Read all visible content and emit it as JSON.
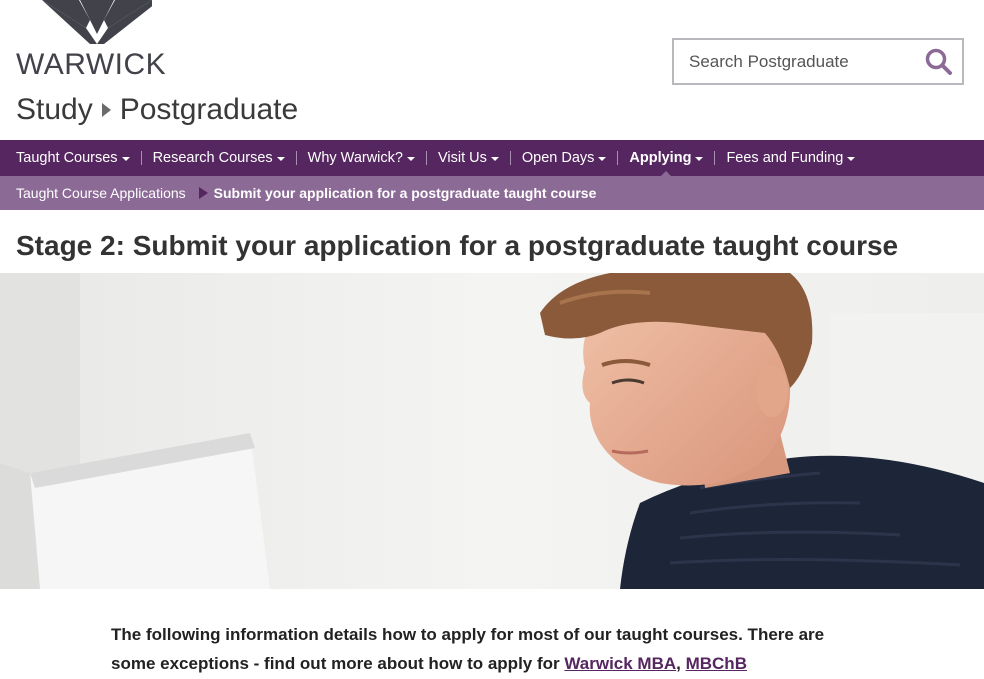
{
  "header": {
    "logo_text": "WARWICK",
    "search": {
      "placeholder": "Search Postgraduate"
    },
    "breadcrumb": {
      "parent": "Study",
      "current": "Postgraduate"
    }
  },
  "nav": {
    "items": [
      {
        "label": "Taught Courses"
      },
      {
        "label": "Research Courses"
      },
      {
        "label": "Why Warwick?"
      },
      {
        "label": "Visit Us"
      },
      {
        "label": "Open Days"
      },
      {
        "label": "Applying"
      },
      {
        "label": "Fees and Funding"
      }
    ],
    "active_index": 5
  },
  "subnav": {
    "parent": "Taught Course Applications",
    "current": "Submit your application for a postgraduate taught course"
  },
  "page": {
    "title": "Stage 2: Submit your application for a postgraduate taught course"
  },
  "intro": {
    "text_before": "The following information details how to apply for most of our taught courses. There are some exceptions - find out more about how to apply for ",
    "link1": "Warwick MBA",
    "sep": ", ",
    "link2": "MBChB"
  },
  "colors": {
    "brand_purple": "#55265f",
    "subnav_purple": "#8c6a96",
    "logo_grey": "#41424a"
  },
  "icons": [
    "warwick-logo-mark",
    "search-icon",
    "caret-down-icon",
    "breadcrumb-arrow-icon"
  ]
}
